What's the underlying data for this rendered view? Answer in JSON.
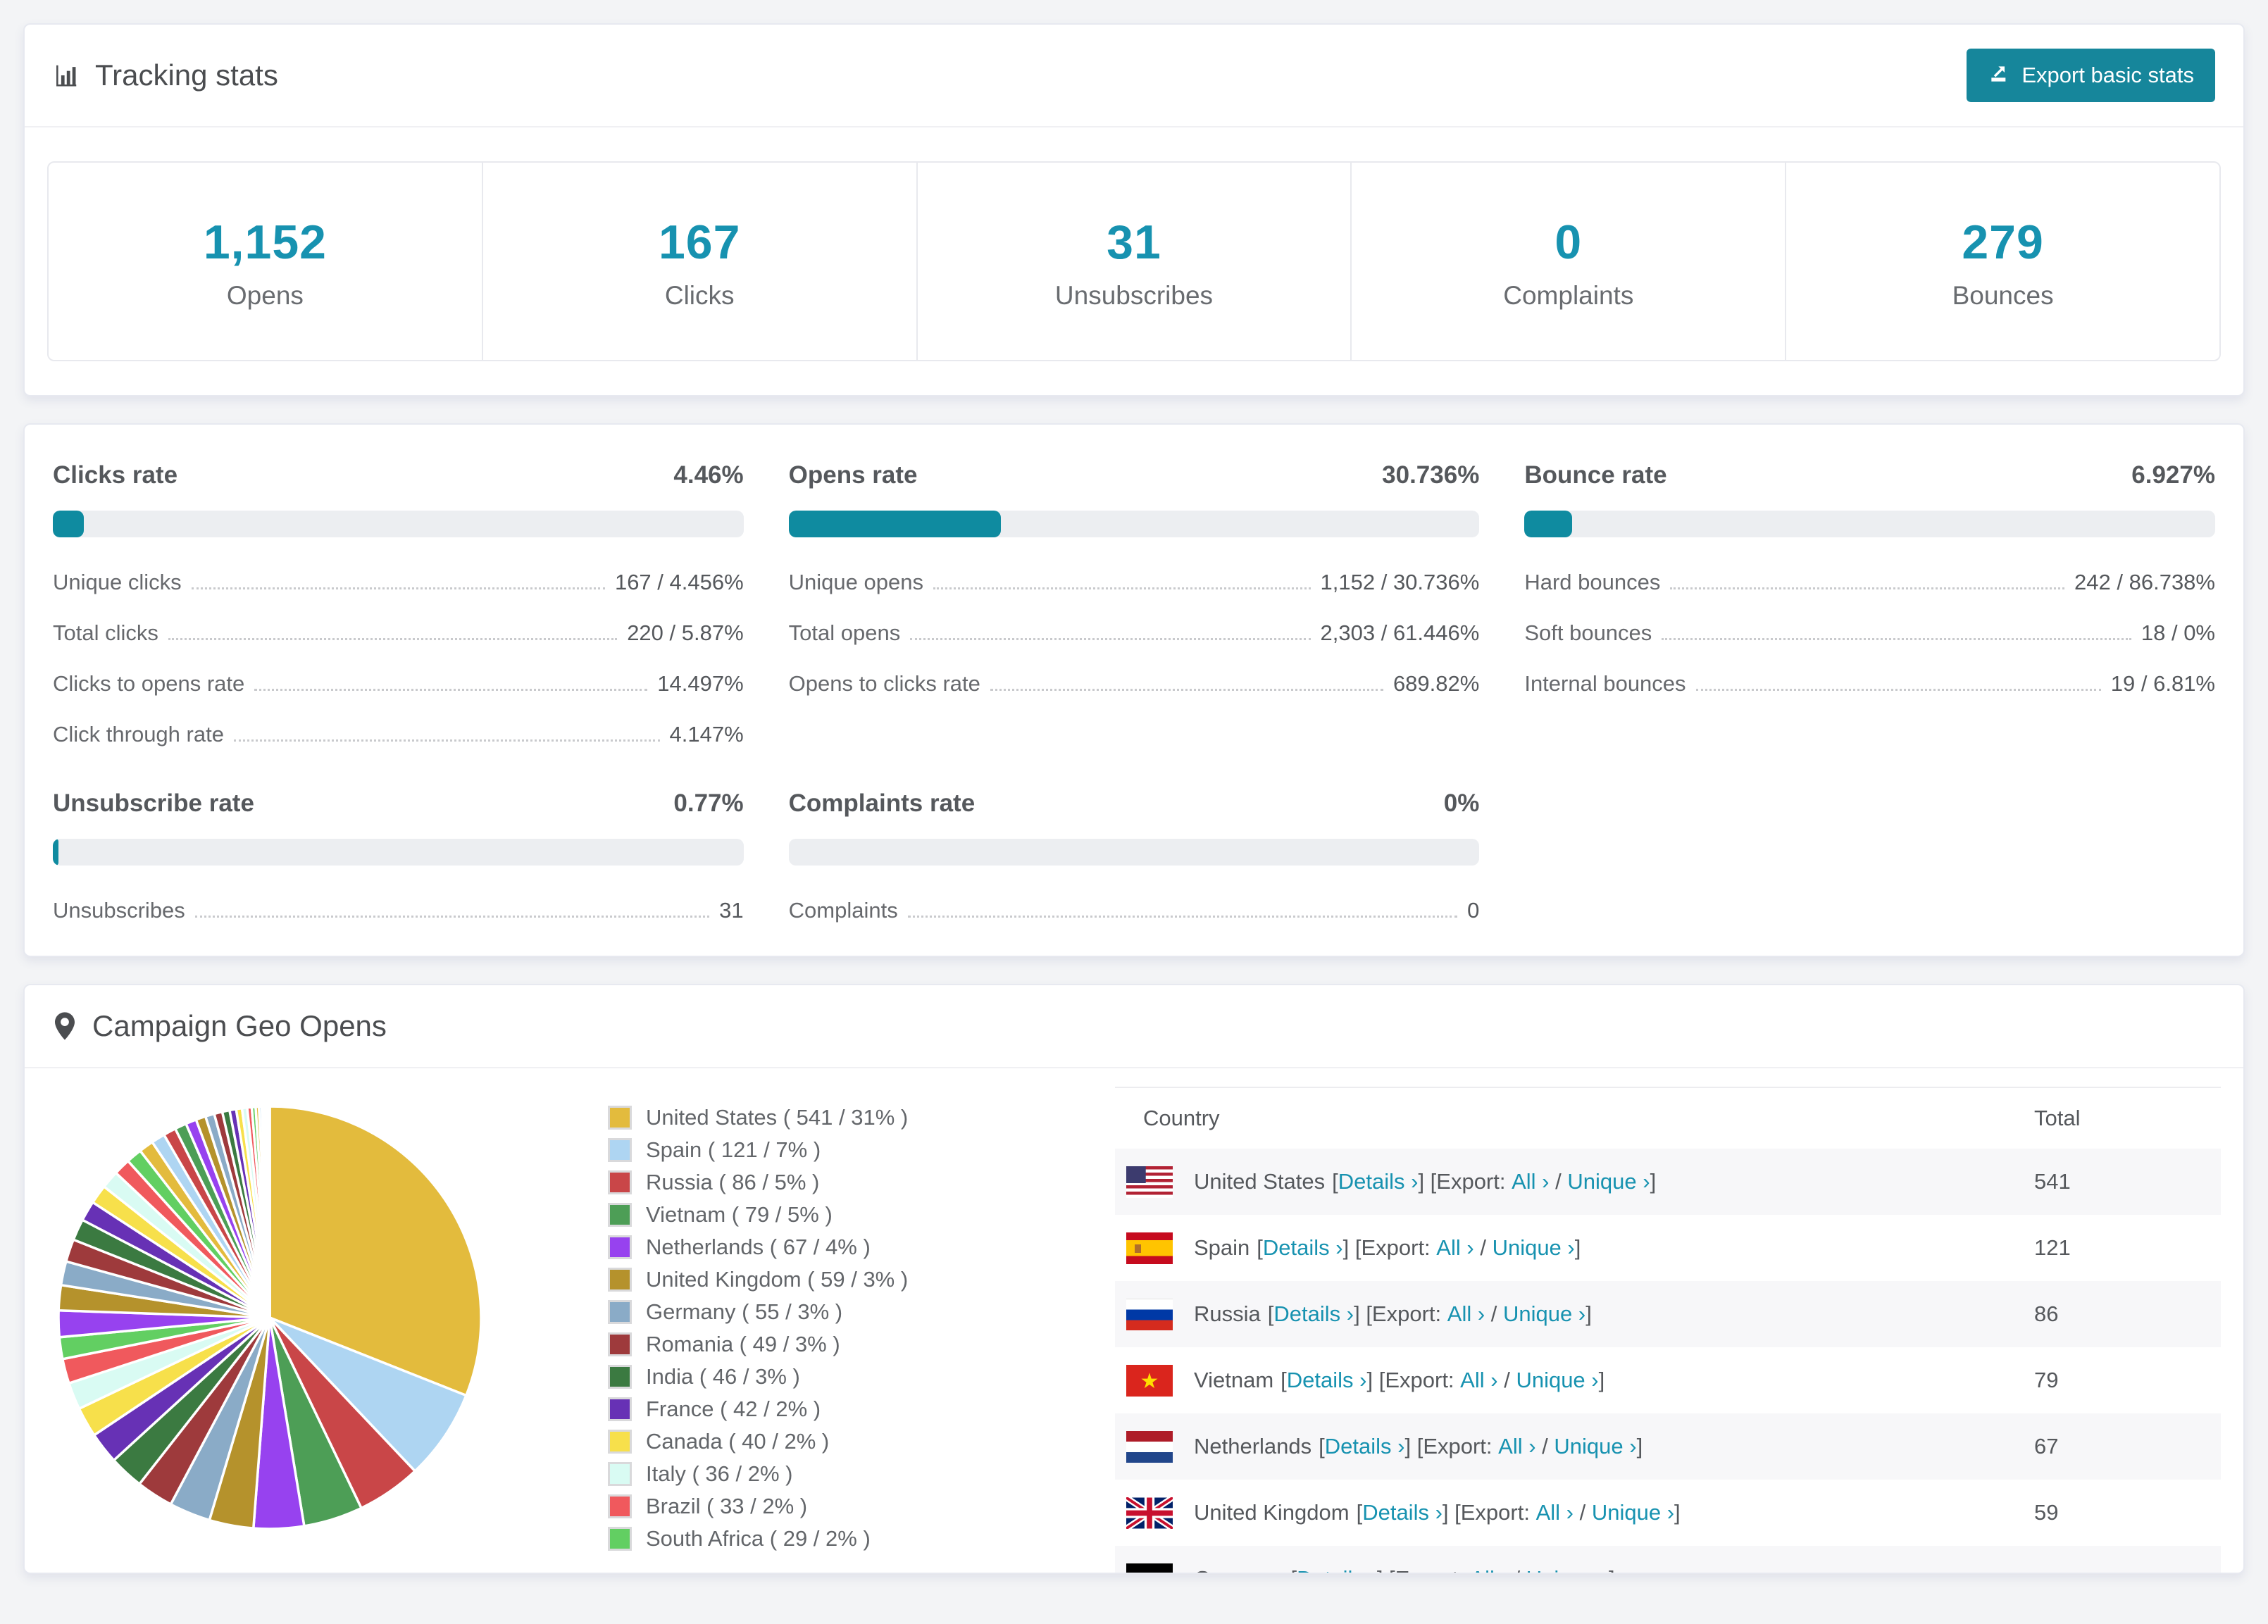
{
  "colors": {
    "accent_text": "#1792b0",
    "accent_fill": "#0f8ba0",
    "button_bg": "#16869b",
    "page_bg": "#f3f4f6",
    "row_alt_bg": "#f7f7f9"
  },
  "tracking": {
    "title": "Tracking stats",
    "export_button": "Export basic stats",
    "stats": [
      {
        "value": "1,152",
        "label": "Opens"
      },
      {
        "value": "167",
        "label": "Clicks"
      },
      {
        "value": "31",
        "label": "Unsubscribes"
      },
      {
        "value": "0",
        "label": "Complaints"
      },
      {
        "value": "279",
        "label": "Bounces"
      }
    ]
  },
  "rates": {
    "clicks": {
      "title": "Clicks rate",
      "value": "4.46%",
      "percent": 4.46,
      "rows": [
        {
          "label": "Unique clicks",
          "value": "167 / 4.456%"
        },
        {
          "label": "Total clicks",
          "value": "220 / 5.87%"
        },
        {
          "label": "Clicks to opens rate",
          "value": "14.497%"
        },
        {
          "label": "Click through rate",
          "value": "4.147%"
        }
      ]
    },
    "opens": {
      "title": "Opens rate",
      "value": "30.736%",
      "percent": 30.736,
      "rows": [
        {
          "label": "Unique opens",
          "value": "1,152 / 30.736%"
        },
        {
          "label": "Total opens",
          "value": "2,303 / 61.446%"
        },
        {
          "label": "Opens to clicks rate",
          "value": "689.82%"
        }
      ]
    },
    "bounce": {
      "title": "Bounce rate",
      "value": "6.927%",
      "percent": 6.927,
      "rows": [
        {
          "label": "Hard bounces",
          "value": "242 / 86.738%"
        },
        {
          "label": "Soft bounces",
          "value": "18 / 0%"
        },
        {
          "label": "Internal bounces",
          "value": "19 / 6.81%"
        }
      ]
    },
    "unsubscribe": {
      "title": "Unsubscribe rate",
      "value": "0.77%",
      "percent": 0.77,
      "rows": [
        {
          "label": "Unsubscribes",
          "value": "31"
        }
      ]
    },
    "complaints": {
      "title": "Complaints rate",
      "value": "0%",
      "percent": 0,
      "rows": [
        {
          "label": "Complaints",
          "value": "0"
        }
      ]
    }
  },
  "geo": {
    "title": "Campaign Geo Opens",
    "legend": [
      {
        "label": "United States ( 541 / 31% )"
      },
      {
        "label": "Spain ( 121 / 7% )"
      },
      {
        "label": "Russia ( 86 / 5% )"
      },
      {
        "label": "Vietnam ( 79 / 5% )"
      },
      {
        "label": "Netherlands ( 67 / 4% )"
      },
      {
        "label": "United Kingdom ( 59 / 3% )"
      },
      {
        "label": "Germany ( 55 / 3% )"
      },
      {
        "label": "Romania ( 49 / 3% )"
      },
      {
        "label": "India ( 46 / 3% )"
      },
      {
        "label": "France ( 42 / 2% )"
      },
      {
        "label": "Canada ( 40 / 2% )"
      },
      {
        "label": "Italy ( 36 / 2% )"
      },
      {
        "label": "Brazil ( 33 / 2% )"
      },
      {
        "label": "South Africa ( 29 / 2% )"
      }
    ],
    "table": {
      "headers": {
        "country": "Country",
        "total": "Total"
      },
      "syntax": {
        "open": "[",
        "details": "Details ›",
        "close_export": "] [Export:",
        "all": "All ›",
        "slash": "/",
        "unique": "Unique ›",
        "close": "]"
      },
      "rows": [
        {
          "country": "United States",
          "total": "541",
          "flag": "us"
        },
        {
          "country": "Spain",
          "total": "121",
          "flag": "es"
        },
        {
          "country": "Russia",
          "total": "86",
          "flag": "ru"
        },
        {
          "country": "Vietnam",
          "total": "79",
          "flag": "vn"
        },
        {
          "country": "Netherlands",
          "total": "67",
          "flag": "nl"
        },
        {
          "country": "United Kingdom",
          "total": "59",
          "flag": "gb"
        },
        {
          "country": "Germany",
          "total": "",
          "flag": "de",
          "partial": true
        }
      ]
    }
  },
  "chart_data": {
    "type": "pie",
    "title": "Campaign Geo Opens",
    "categories": [
      "United States",
      "Spain",
      "Russia",
      "Vietnam",
      "Netherlands",
      "United Kingdom",
      "Germany",
      "Romania",
      "India",
      "France",
      "Canada",
      "Italy",
      "Brazil",
      "South Africa"
    ],
    "values": [
      541,
      121,
      86,
      79,
      67,
      59,
      55,
      49,
      46,
      42,
      40,
      36,
      33,
      29
    ],
    "percent_labels": [
      "31%",
      "7%",
      "5%",
      "5%",
      "4%",
      "3%",
      "3%",
      "3%",
      "3%",
      "2%",
      "2%",
      "2%",
      "2%",
      "2%"
    ],
    "colors": [
      "#e3bb3d",
      "#aed5f2",
      "#c94648",
      "#4d9e56",
      "#9742ef",
      "#b5922c",
      "#8aabc7",
      "#9e3a3c",
      "#3b7a41",
      "#6731b5",
      "#f7e04b",
      "#d9fbf3",
      "#f0595d",
      "#62cf62"
    ],
    "other_small_slices": {
      "approx_total": 462,
      "count": 34
    },
    "start_angle_deg": -90,
    "direction": "clockwise",
    "legend_position": "right"
  }
}
